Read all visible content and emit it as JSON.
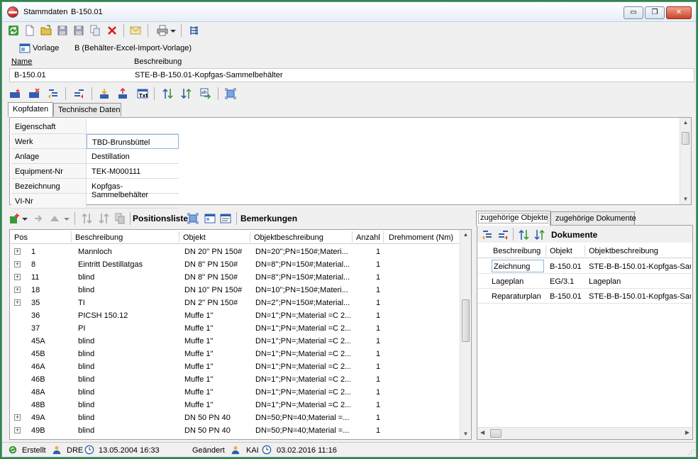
{
  "window": {
    "title": "Stammdaten",
    "record_id": "B-150.01",
    "controls": {
      "minimize": "▭",
      "maximize": "❐",
      "close": "✕"
    }
  },
  "toolbar1": {
    "icons": [
      "refresh-icon",
      "new-document-icon",
      "open-folder-icon",
      "save-icon",
      "save-as-icon",
      "copy-icon",
      "delete-icon",
      "mail-icon",
      "print-icon",
      "hierarchy-icon"
    ]
  },
  "vorlage": {
    "label": "Vorlage",
    "value": "B (Behälter-Excel-Import-Vorlage)"
  },
  "header": {
    "name_label": "Name",
    "description_label": "Beschreibung",
    "name_value": "B-150.01",
    "description_value": "STE-B-B-150.01-Kopfgas-Sammelbehälter"
  },
  "tabs_top": [
    {
      "label": "Kopfdaten",
      "active": true
    },
    {
      "label": "Technische Daten",
      "active": false
    }
  ],
  "properties": [
    {
      "label": "Eigenschaft",
      "value": ""
    },
    {
      "label": "Werk",
      "value": "TBD-Brunsbüttel"
    },
    {
      "label": "Anlage",
      "value": "Destillation"
    },
    {
      "label": "Equipment-Nr",
      "value": "TEK-M000111"
    },
    {
      "label": "Bezeichnung",
      "value": "Kopfgas-Sammelbehälter"
    },
    {
      "label": "VI-Nr",
      "value": ""
    }
  ],
  "toolbar3": {
    "positionsliste_label": "Positionsliste",
    "bemerkungen_label": "Bemerkungen"
  },
  "positions": {
    "columns": [
      "Pos",
      "Beschreibung",
      "Objekt",
      "Objektbeschreibung",
      "Anzahl",
      "Drehmoment (Nm)"
    ],
    "rows": [
      {
        "expandable": true,
        "pos": "1",
        "beschreibung": "Mannloch",
        "objekt": "DN 20'' PN 150#",
        "objektbeschreibung": "DN=20'';PN=150#;Materi...",
        "anzahl": "1"
      },
      {
        "expandable": true,
        "pos": "8",
        "beschreibung": "Eintritt Destillatgas",
        "objekt": "DN 8'' PN 150#",
        "objektbeschreibung": "DN=8'';PN=150#;Material...",
        "anzahl": "1"
      },
      {
        "expandable": true,
        "pos": "11",
        "beschreibung": "blind",
        "objekt": "DN 8'' PN 150#",
        "objektbeschreibung": "DN=8'';PN=150#;Material...",
        "anzahl": "1"
      },
      {
        "expandable": true,
        "pos": "18",
        "beschreibung": "blind",
        "objekt": "DN 10'' PN 150#",
        "objektbeschreibung": "DN=10'';PN=150#;Materi...",
        "anzahl": "1"
      },
      {
        "expandable": true,
        "pos": "35",
        "beschreibung": "TI",
        "objekt": "DN 2'' PN 150#",
        "objektbeschreibung": "DN=2'';PN=150#;Material...",
        "anzahl": "1"
      },
      {
        "expandable": false,
        "pos": "36",
        "beschreibung": "PICSH 150.12",
        "objekt": "Muffe 1''",
        "objektbeschreibung": "DN=1'';PN=;Material =C 2...",
        "anzahl": "1"
      },
      {
        "expandable": false,
        "pos": "37",
        "beschreibung": "PI",
        "objekt": "Muffe 1''",
        "objektbeschreibung": "DN=1'';PN=;Material =C 2...",
        "anzahl": "1"
      },
      {
        "expandable": false,
        "pos": "45A",
        "beschreibung": "blind",
        "objekt": "Muffe 1''",
        "objektbeschreibung": "DN=1'';PN=;Material =C 2...",
        "anzahl": "1"
      },
      {
        "expandable": false,
        "pos": "45B",
        "beschreibung": "blind",
        "objekt": "Muffe 1''",
        "objektbeschreibung": "DN=1'';PN=;Material =C 2...",
        "anzahl": "1"
      },
      {
        "expandable": false,
        "pos": "46A",
        "beschreibung": "blind",
        "objekt": "Muffe 1''",
        "objektbeschreibung": "DN=1'';PN=;Material =C 2...",
        "anzahl": "1"
      },
      {
        "expandable": false,
        "pos": "46B",
        "beschreibung": "blind",
        "objekt": "Muffe 1''",
        "objektbeschreibung": "DN=1'';PN=;Material =C 2...",
        "anzahl": "1"
      },
      {
        "expandable": false,
        "pos": "48A",
        "beschreibung": "blind",
        "objekt": "Muffe 1''",
        "objektbeschreibung": "DN=1'';PN=;Material =C 2...",
        "anzahl": "1"
      },
      {
        "expandable": false,
        "pos": "48B",
        "beschreibung": "blind",
        "objekt": "Muffe 1''",
        "objektbeschreibung": "DN=1'';PN=;Material =C 2...",
        "anzahl": "1"
      },
      {
        "expandable": true,
        "pos": "49A",
        "beschreibung": "blind",
        "objekt": "DN 50 PN 40",
        "objektbeschreibung": "DN=50;PN=40;Material =...",
        "anzahl": "1"
      },
      {
        "expandable": true,
        "pos": "49B",
        "beschreibung": "blind",
        "objekt": "DN 50 PN 40",
        "objektbeschreibung": "DN=50;PN=40;Material =...",
        "anzahl": "1"
      }
    ]
  },
  "tabs_right": [
    {
      "label": "zugehörige Objekte",
      "active": true
    },
    {
      "label": "zugehörige Dokumente",
      "active": false
    }
  ],
  "documents": {
    "title": "Dokumente",
    "columns": [
      "Beschreibung",
      "Objekt",
      "Objektbeschreibung"
    ],
    "rows": [
      {
        "beschreibung": "Zeichnung",
        "objekt": "B-150.01",
        "objektbeschreibung": "STE-B-B-150.01-Kopfgas-Sam",
        "selected": true
      },
      {
        "beschreibung": "Lageplan",
        "objekt": "EG/3.1",
        "objektbeschreibung": "Lageplan",
        "selected": false
      },
      {
        "beschreibung": "Reparaturplan",
        "objekt": "B-150.01",
        "objektbeschreibung": "STE-B-B-150.01-Kopfgas-Sam",
        "selected": false
      }
    ]
  },
  "status": {
    "created_label": "Erstellt",
    "created_user": "DRE",
    "created_date": "13.05.2004 16:33",
    "changed_label": "Geändert",
    "changed_user": "KAI",
    "changed_date": "03.02.2016 11:16"
  },
  "colors": {
    "frame": "#2e8b3a",
    "panel": "#f0f0f0",
    "selection_border": "#8fb4e0"
  }
}
